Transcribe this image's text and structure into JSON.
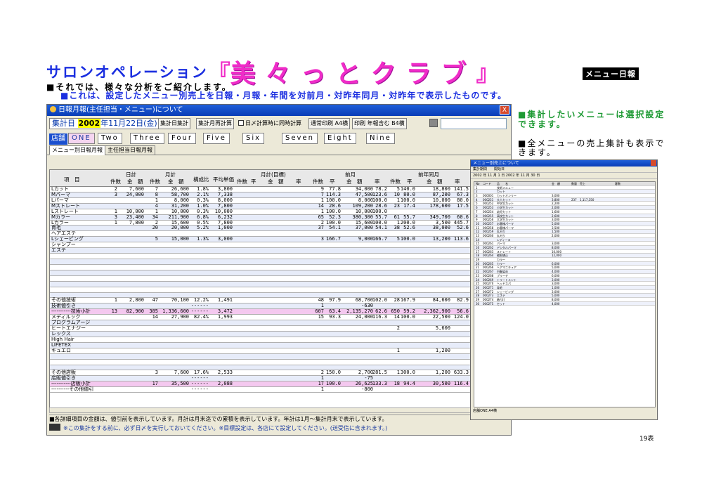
{
  "title": {
    "subtitle": "サロンオペレーション",
    "open_bracket": "『",
    "main": "美々っとクラブ",
    "close_bracket": "』",
    "badge": "メニュー日報"
  },
  "desc": {
    "line1": "■それでは、様々な分析をご紹介します。",
    "line2": "■これは、設定したメニュー別売上を日報・月報・年間を対前月・対昨年同月・対昨年で表示したものです。"
  },
  "notes": {
    "note1": "■集計したいメニューは選択設定できます。",
    "note2": "■全メニューの売上集計も表示できます。"
  },
  "page_number": "19表",
  "window": {
    "title": "日報月報(主任担当・メニュー)について",
    "close": "X",
    "date_label": "集計日",
    "date_year": "2002",
    "date_rest": "年11月22日(金)",
    "btn_daily": "集計日集計",
    "btn_month": "集計月再計算",
    "chk_label": "日〆計算時に同時計算",
    "btn_print_a4": "通常印刷 A4横",
    "btn_print_b4": "印刷 年報含む B4横",
    "store_label": "店舗",
    "store_tabs": [
      "ONE",
      "Two",
      "Three",
      "Four",
      "Five",
      "Six",
      "Seven",
      "Eight",
      "Nine"
    ],
    "sub_tabs": [
      "メニュー別日報月報",
      "主任担当日報月報"
    ],
    "headers": {
      "item": "項　目",
      "daily": "日計",
      "monthly": "月計",
      "ratio": "構成比",
      "avg": "平均単価",
      "target": "月計(目標)",
      "prev_month": "前月",
      "prev_year": "前年同月",
      "annual": "年間",
      "count": "件数",
      "amount": "金　額",
      "rate": "率",
      "sub_count": "件数",
      "sub_ratio": "平",
      "sub_amount": "金　額",
      "sub_rate": "率"
    },
    "rows": [
      {
        "name": "Lカット",
        "d_cnt": "2",
        "d_amt": "7,600",
        "m_cnt": "7",
        "m_amt": "26,600",
        "ratio": "1.8%",
        "avg": "3,800",
        "pm_cnt": "9",
        "pm_r": "77.8",
        "pm_amt": "34,000",
        "pm_rate": "78.2",
        "py_cnt": "5",
        "py_r": "140.0",
        "py_amt": "18,800",
        "py_rate": "141.5",
        "style": ""
      },
      {
        "name": "Mパーマ",
        "d_cnt": "3",
        "d_amt": "24,000",
        "m_cnt": "8",
        "m_amt": "58,700",
        "ratio": "2.1%",
        "avg": "7,338",
        "pm_cnt": "7",
        "pm_r": "114.3",
        "pm_amt": "47,500",
        "pm_rate": "123.6",
        "py_cnt": "10",
        "py_r": "80.0",
        "py_amt": "87,200",
        "py_rate": "67.3",
        "style": "stripe"
      },
      {
        "name": "Lパーマ",
        "d_cnt": "",
        "d_amt": "",
        "m_cnt": "1",
        "m_amt": "8,000",
        "ratio": "0.3%",
        "avg": "8,000",
        "pm_cnt": "1",
        "pm_r": "100.0",
        "pm_amt": "8,000",
        "pm_rate": "100.0",
        "py_cnt": "1",
        "py_r": "100.0",
        "py_amt": "10,000",
        "py_rate": "80.0",
        "style": ""
      },
      {
        "name": "Mストレート",
        "d_cnt": "",
        "d_amt": "",
        "m_cnt": "4",
        "m_amt": "31,200",
        "ratio": "1.0%",
        "avg": "7,800",
        "pm_cnt": "14",
        "pm_r": "28.6",
        "pm_amt": "109,200",
        "pm_rate": "28.6",
        "py_cnt": "23",
        "py_r": "17.4",
        "py_amt": "178,600",
        "py_rate": "17.5",
        "style": "stripe"
      },
      {
        "name": "Lストレート",
        "d_cnt": "1",
        "d_amt": "10,000",
        "m_cnt": "1",
        "m_amt": "10,000",
        "ratio": "0.3%",
        "avg": "10,000",
        "pm_cnt": "1",
        "pm_r": "100.0",
        "pm_amt": "10,000",
        "pm_rate": "100.0",
        "py_cnt": "",
        "py_r": "",
        "py_amt": "",
        "py_rate": "",
        "style": ""
      },
      {
        "name": "Mカラー",
        "d_cnt": "3",
        "d_amt": "23,400",
        "m_cnt": "34",
        "m_amt": "211,900",
        "ratio": "6.8%",
        "avg": "6,232",
        "pm_cnt": "65",
        "pm_r": "52.3",
        "pm_amt": "380,300",
        "pm_rate": "55.7",
        "py_cnt": "61",
        "py_r": "55.7",
        "py_amt": "349,700",
        "py_rate": "60.6",
        "style": "stripe"
      },
      {
        "name": "Lカラー",
        "d_cnt": "1",
        "d_amt": "7,800",
        "m_cnt": "2",
        "m_amt": "15,600",
        "ratio": "0.5%",
        "avg": "7,800",
        "pm_cnt": "2",
        "pm_r": "100.0",
        "pm_amt": "15,600",
        "pm_rate": "100.0",
        "py_cnt": "1",
        "py_r": "200.0",
        "py_amt": "3,500",
        "py_rate": "445.7",
        "style": ""
      },
      {
        "name": "育毛",
        "d_cnt": "",
        "d_amt": "",
        "m_cnt": "20",
        "m_amt": "20,000",
        "ratio": "5.2%",
        "avg": "1,000",
        "pm_cnt": "37",
        "pm_r": "54.1",
        "pm_amt": "37,000",
        "pm_rate": "54.1",
        "py_cnt": "38",
        "py_r": "52.6",
        "py_amt": "38,000",
        "py_rate": "52.6",
        "style": "stripe"
      },
      {
        "name": "ヘアエステ",
        "d_cnt": "",
        "d_amt": "",
        "m_cnt": "",
        "m_amt": "",
        "ratio": "",
        "avg": "",
        "pm_cnt": "",
        "pm_r": "",
        "pm_amt": "",
        "pm_rate": "",
        "py_cnt": "",
        "py_r": "",
        "py_amt": "",
        "py_rate": "",
        "style": ""
      },
      {
        "name": "Lシェービング",
        "d_cnt": "",
        "d_amt": "",
        "m_cnt": "5",
        "m_amt": "15,000",
        "ratio": "1.3%",
        "avg": "3,000",
        "pm_cnt": "3",
        "pm_r": "166.7",
        "pm_amt": "9,000",
        "pm_rate": "166.7",
        "py_cnt": "5",
        "py_r": "100.0",
        "py_amt": "13,200",
        "py_rate": "113.6",
        "style": "stripe"
      },
      {
        "name": "シャンプー",
        "d_cnt": "",
        "d_amt": "",
        "m_cnt": "",
        "m_amt": "",
        "ratio": "",
        "avg": "",
        "pm_cnt": "",
        "pm_r": "",
        "pm_amt": "",
        "pm_rate": "",
        "py_cnt": "",
        "py_r": "",
        "py_amt": "",
        "py_rate": "",
        "style": ""
      },
      {
        "name": "エステ",
        "d_cnt": "",
        "d_amt": "",
        "m_cnt": "",
        "m_amt": "",
        "ratio": "",
        "avg": "",
        "pm_cnt": "",
        "pm_r": "",
        "pm_amt": "",
        "pm_rate": "",
        "py_cnt": "",
        "py_r": "",
        "py_amt": "",
        "py_rate": "",
        "style": "stripe"
      },
      {
        "name": "",
        "d_cnt": "",
        "d_amt": "",
        "m_cnt": "",
        "m_amt": "",
        "ratio": "",
        "avg": "",
        "pm_cnt": "",
        "pm_r": "",
        "pm_amt": "",
        "pm_rate": "",
        "py_cnt": "",
        "py_r": "",
        "py_amt": "",
        "py_rate": "",
        "style": ""
      },
      {
        "name": "",
        "d_cnt": "",
        "d_amt": "",
        "m_cnt": "",
        "m_amt": "",
        "ratio": "",
        "avg": "",
        "pm_cnt": "",
        "pm_r": "",
        "pm_amt": "",
        "pm_rate": "",
        "py_cnt": "",
        "py_r": "",
        "py_amt": "",
        "py_rate": "",
        "style": "stripe"
      },
      {
        "name": "",
        "d_cnt": "",
        "d_amt": "",
        "m_cnt": "",
        "m_amt": "",
        "ratio": "",
        "avg": "",
        "pm_cnt": "",
        "pm_r": "",
        "pm_amt": "",
        "pm_rate": "",
        "py_cnt": "",
        "py_r": "",
        "py_amt": "",
        "py_rate": "",
        "style": ""
      },
      {
        "name": "",
        "d_cnt": "",
        "d_amt": "",
        "m_cnt": "",
        "m_amt": "",
        "ratio": "",
        "avg": "",
        "pm_cnt": "",
        "pm_r": "",
        "pm_amt": "",
        "pm_rate": "",
        "py_cnt": "",
        "py_r": "",
        "py_amt": "",
        "py_rate": "",
        "style": "stripe"
      },
      {
        "name": "",
        "d_cnt": "",
        "d_amt": "",
        "m_cnt": "",
        "m_amt": "",
        "ratio": "",
        "avg": "",
        "pm_cnt": "",
        "pm_r": "",
        "pm_amt": "",
        "pm_rate": "",
        "py_cnt": "",
        "py_r": "",
        "py_amt": "",
        "py_rate": "",
        "style": ""
      },
      {
        "name": "",
        "d_cnt": "",
        "d_amt": "",
        "m_cnt": "",
        "m_amt": "",
        "ratio": "",
        "avg": "",
        "pm_cnt": "",
        "pm_r": "",
        "pm_amt": "",
        "pm_rate": "",
        "py_cnt": "",
        "py_r": "",
        "py_amt": "",
        "py_rate": "",
        "style": "stripe"
      },
      {
        "name": "",
        "d_cnt": "",
        "d_amt": "",
        "m_cnt": "",
        "m_amt": "",
        "ratio": "",
        "avg": "",
        "pm_cnt": "",
        "pm_r": "",
        "pm_amt": "",
        "pm_rate": "",
        "py_cnt": "",
        "py_r": "",
        "py_amt": "",
        "py_rate": "",
        "style": ""
      },
      {
        "name": "",
        "d_cnt": "",
        "d_amt": "",
        "m_cnt": "",
        "m_amt": "",
        "ratio": "",
        "avg": "",
        "pm_cnt": "",
        "pm_r": "",
        "pm_amt": "",
        "pm_rate": "",
        "py_cnt": "",
        "py_r": "",
        "py_amt": "",
        "py_rate": "",
        "style": "stripe"
      },
      {
        "name": "その他技術",
        "d_cnt": "1",
        "d_amt": "2,800",
        "m_cnt": "47",
        "m_amt": "70,100",
        "ratio": "12.2%",
        "avg": "1,491",
        "pm_cnt": "48",
        "pm_r": "97.9",
        "pm_amt": "68,700",
        "pm_rate": "102.0",
        "py_cnt": "28",
        "py_r": "167.9",
        "py_amt": "84,600",
        "py_rate": "82.9",
        "style": ""
      },
      {
        "name": "技術値引き",
        "d_cnt": "",
        "d_amt": "",
        "m_cnt": "",
        "m_amt": "",
        "ratio": "------",
        "avg": "",
        "pm_cnt": "1",
        "pm_r": "",
        "pm_amt": "-630",
        "pm_rate": "",
        "py_cnt": "",
        "py_r": "",
        "py_amt": "",
        "py_rate": "",
        "style": "stripe"
      },
      {
        "name": "-----------技術小計",
        "d_cnt": "13",
        "d_amt": "82,900",
        "m_cnt": "385",
        "m_amt": "1,336,600",
        "ratio": "------",
        "avg": "3,472",
        "pm_cnt": "607",
        "pm_r": "63.4",
        "pm_amt": "2,135,270",
        "pm_rate": "62.6",
        "py_cnt": "650",
        "py_r": "59.2",
        "py_amt": "2,362,900",
        "py_rate": "56.6",
        "style": "pink"
      },
      {
        "name": "メディルック",
        "d_cnt": "",
        "d_amt": "",
        "m_cnt": "14",
        "m_amt": "27,900",
        "ratio": "82.4%",
        "avg": "1,993",
        "pm_cnt": "15",
        "pm_r": "93.3",
        "pm_amt": "24,000",
        "pm_rate": "116.3",
        "py_cnt": "14",
        "py_r": "100.0",
        "py_amt": "22,500",
        "py_rate": "124.0",
        "style": ""
      },
      {
        "name": "プログラムアージ",
        "d_cnt": "",
        "d_amt": "",
        "m_cnt": "",
        "m_amt": "",
        "ratio": "",
        "avg": "",
        "pm_cnt": "",
        "pm_r": "",
        "pm_amt": "",
        "pm_rate": "",
        "py_cnt": "",
        "py_r": "",
        "py_amt": "",
        "py_rate": "",
        "style": "stripe"
      },
      {
        "name": "ヒートエナジー",
        "d_cnt": "",
        "d_amt": "",
        "m_cnt": "",
        "m_amt": "",
        "ratio": "",
        "avg": "",
        "pm_cnt": "",
        "pm_r": "",
        "pm_amt": "",
        "pm_rate": "",
        "py_cnt": "2",
        "py_r": "",
        "py_amt": "5,600",
        "py_rate": "",
        "style": ""
      },
      {
        "name": "レックス",
        "d_cnt": "",
        "d_amt": "",
        "m_cnt": "",
        "m_amt": "",
        "ratio": "",
        "avg": "",
        "pm_cnt": "",
        "pm_r": "",
        "pm_amt": "",
        "pm_rate": "",
        "py_cnt": "",
        "py_r": "",
        "py_amt": "",
        "py_rate": "",
        "style": "stripe"
      },
      {
        "name": "High Hair",
        "d_cnt": "",
        "d_amt": "",
        "m_cnt": "",
        "m_amt": "",
        "ratio": "",
        "avg": "",
        "pm_cnt": "",
        "pm_r": "",
        "pm_amt": "",
        "pm_rate": "",
        "py_cnt": "",
        "py_r": "",
        "py_amt": "",
        "py_rate": "",
        "style": ""
      },
      {
        "name": "LIFETEX",
        "d_cnt": "",
        "d_amt": "",
        "m_cnt": "",
        "m_amt": "",
        "ratio": "",
        "avg": "",
        "pm_cnt": "",
        "pm_r": "",
        "pm_amt": "",
        "pm_rate": "",
        "py_cnt": "",
        "py_r": "",
        "py_amt": "",
        "py_rate": "",
        "style": "stripe"
      },
      {
        "name": "キュエロ",
        "d_cnt": "",
        "d_amt": "",
        "m_cnt": "",
        "m_amt": "",
        "ratio": "",
        "avg": "",
        "pm_cnt": "",
        "pm_r": "",
        "pm_amt": "",
        "pm_rate": "",
        "py_cnt": "1",
        "py_r": "",
        "py_amt": "1,200",
        "py_rate": "",
        "style": ""
      },
      {
        "name": "",
        "d_cnt": "",
        "d_amt": "",
        "m_cnt": "",
        "m_amt": "",
        "ratio": "",
        "avg": "",
        "pm_cnt": "",
        "pm_r": "",
        "pm_amt": "",
        "pm_rate": "",
        "py_cnt": "",
        "py_r": "",
        "py_amt": "",
        "py_rate": "",
        "style": "stripe"
      },
      {
        "name": "",
        "d_cnt": "",
        "d_amt": "",
        "m_cnt": "",
        "m_amt": "",
        "ratio": "",
        "avg": "",
        "pm_cnt": "",
        "pm_r": "",
        "pm_amt": "",
        "pm_rate": "",
        "py_cnt": "",
        "py_r": "",
        "py_amt": "",
        "py_rate": "",
        "style": ""
      },
      {
        "name": "",
        "d_cnt": "",
        "d_amt": "",
        "m_cnt": "",
        "m_amt": "",
        "ratio": "",
        "avg": "",
        "pm_cnt": "",
        "pm_r": "",
        "pm_amt": "",
        "pm_rate": "",
        "py_cnt": "",
        "py_r": "",
        "py_amt": "",
        "py_rate": "",
        "style": "stripe"
      },
      {
        "name": "その他店販",
        "d_cnt": "",
        "d_amt": "",
        "m_cnt": "3",
        "m_amt": "7,600",
        "ratio": "17.6%",
        "avg": "2,533",
        "pm_cnt": "2",
        "pm_r": "150.0",
        "pm_amt": "2,700",
        "pm_rate": "281.5",
        "py_cnt": "1",
        "py_r": "300.0",
        "py_amt": "1,200",
        "py_rate": "633.3",
        "style": ""
      },
      {
        "name": "店販値引き",
        "d_cnt": "",
        "d_amt": "",
        "m_cnt": "",
        "m_amt": "",
        "ratio": "------",
        "avg": "",
        "pm_cnt": "1",
        "pm_r": "",
        "pm_amt": "-75",
        "pm_rate": "",
        "py_cnt": "",
        "py_r": "",
        "py_amt": "",
        "py_rate": "",
        "style": "stripe"
      },
      {
        "name": "-----------店販小計",
        "d_cnt": "",
        "d_amt": "",
        "m_cnt": "17",
        "m_amt": "35,500",
        "ratio": "------",
        "avg": "2,088",
        "pm_cnt": "17",
        "pm_r": "100.0",
        "pm_amt": "26,625",
        "pm_rate": "133.3",
        "py_cnt": "18",
        "py_r": "94.4",
        "py_amt": "30,500",
        "py_rate": "116.4",
        "style": "pink"
      },
      {
        "name": "----------その他値引",
        "d_cnt": "",
        "d_amt": "",
        "m_cnt": "",
        "m_amt": "",
        "ratio": "------",
        "avg": "",
        "pm_cnt": "1",
        "pm_r": "",
        "pm_amt": "-800",
        "pm_rate": "",
        "py_cnt": "",
        "py_r": "",
        "py_amt": "",
        "py_rate": "",
        "style": ""
      }
    ],
    "footer1": "■各詳細項目の金額は、値引前を表示しています。月計は月末迄での累積を表示しています。年計は1月～集計月末で表示しています。",
    "footer2": "※この集計をする前に、必ず日〆を実行しておいてください。※目標設定は、各店にて設定してください。(送受信に含まれます。)"
  },
  "window2": {
    "title": "メニュー別売上について",
    "toolbar": "集計期間　　開始日",
    "range": "2002 年 11 月 1 日  2002 年 11 月 30 日",
    "col_headers": [
      "No",
      "コード",
      "品　　名",
      "金　額",
      "数量",
      "売上",
      "客数"
    ],
    "rows": [
      [
        "1",
        "",
        "技術メニュー",
        "",
        "",
        "",
        ""
      ],
      [
        "2",
        "",
        "カット",
        "",
        "",
        "",
        ""
      ],
      [
        "3",
        "000001",
        "カットオンリー",
        "3,000",
        "",
        "",
        ""
      ],
      [
        "4",
        "000251",
        "大人カット",
        "3,800",
        "237",
        "1,117,350",
        ""
      ],
      [
        "5",
        "000252",
        "中学生カット",
        "2,200",
        "",
        "",
        ""
      ],
      [
        "6",
        "000253",
        "小学生カット",
        "2,000",
        "",
        "",
        ""
      ],
      [
        "7",
        "000254",
        "幼児カット",
        "1,600",
        "",
        "",
        ""
      ],
      [
        "8",
        "000255",
        "高校生カット",
        "2,600",
        "",
        "",
        ""
      ],
      [
        "9",
        "000256",
        "大学生カット",
        "3,000",
        "",
        "",
        ""
      ],
      [
        "10",
        "000257",
        "お客様パーマ",
        "5,000",
        "",
        "",
        ""
      ],
      [
        "11",
        "000258",
        "お客様パーマ",
        "3,500",
        "",
        "",
        ""
      ],
      [
        "12",
        "000259",
        "丸刈り",
        "1,500",
        "",
        "",
        ""
      ],
      [
        "13",
        "000260",
        "丸刈り",
        "2,000",
        "",
        "",
        ""
      ],
      [
        "14",
        "",
        "レディース",
        "",
        "",
        "",
        ""
      ],
      [
        "15",
        "000261",
        "パーマ",
        "3,000",
        "",
        "",
        ""
      ],
      [
        "16",
        "000262",
        "デジタルパーマ",
        "8,000",
        "",
        "",
        ""
      ],
      [
        "17",
        "000263",
        "ストレート",
        "10,000",
        "",
        "",
        ""
      ],
      [
        "18",
        "000264",
        "縮毛矯正",
        "12,000",
        "",
        "",
        ""
      ],
      [
        "19",
        "",
        "カラー",
        "",
        "",
        "",
        ""
      ],
      [
        "20",
        "000265",
        "カラー",
        "6,000",
        "",
        "",
        ""
      ],
      [
        "21",
        "000266",
        "ヘアマニキュア",
        "5,000",
        "",
        "",
        ""
      ],
      [
        "22",
        "000267",
        "白髪染め",
        "4,000",
        "",
        "",
        ""
      ],
      [
        "23",
        "000268",
        "ブリーチ",
        "6,000",
        "",
        "",
        ""
      ],
      [
        "24",
        "000269",
        "トリートメント",
        "3,000",
        "",
        "",
        ""
      ],
      [
        "25",
        "000270",
        "ヘッドスパ",
        "3,000",
        "",
        "",
        ""
      ],
      [
        "26",
        "000271",
        "育毛",
        "1,000",
        "",
        "",
        ""
      ],
      [
        "27",
        "000272",
        "シェービング",
        "3,000",
        "",
        "",
        ""
      ],
      [
        "28",
        "000273",
        "エステ",
        "5,000",
        "",
        "",
        ""
      ],
      [
        "29",
        "000274",
        "着付け",
        "8,000",
        "",
        "",
        ""
      ],
      [
        "30",
        "000275",
        "セット",
        "4,000",
        "",
        "",
        ""
      ]
    ],
    "foot": "店舗ONE  A4横"
  }
}
